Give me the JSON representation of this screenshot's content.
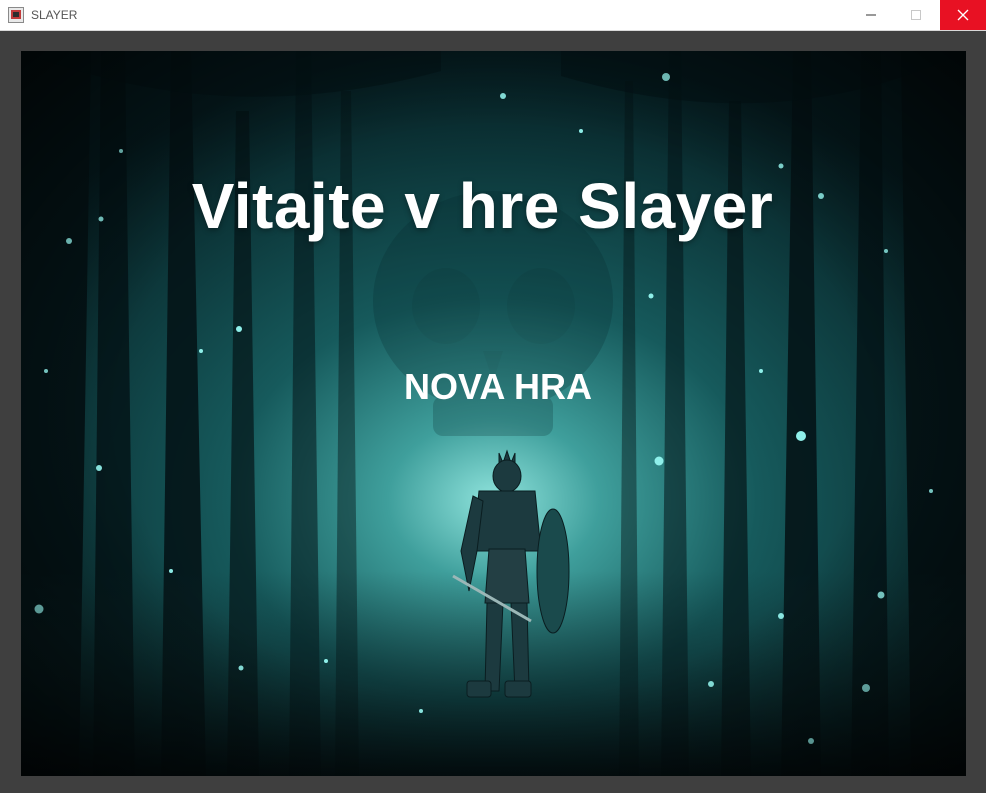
{
  "window": {
    "title": "SLAYER",
    "icon": "app-icon",
    "controls": [
      "minimize-icon",
      "maximize-icon",
      "close-icon"
    ],
    "close_color": "#e81123"
  },
  "scene": {
    "background": "dark-teal-forest-with-skull-and-armored-knight",
    "accent": "#1f7f80"
  },
  "main_menu": {
    "title": "Vitajte v hre Slayer",
    "new_game": "NOVA HRA"
  }
}
